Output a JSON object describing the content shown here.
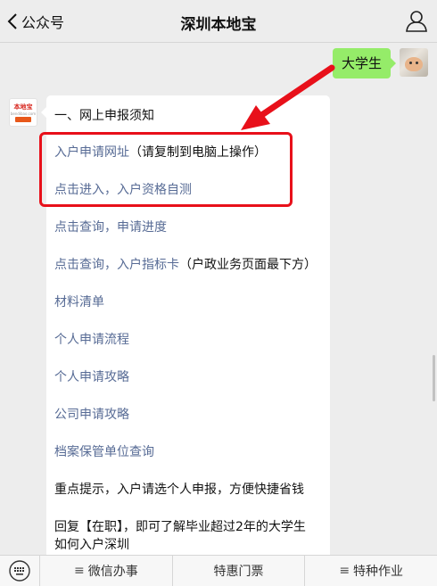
{
  "header": {
    "back_label": "公众号",
    "title": "深圳本地宝"
  },
  "outgoing": {
    "text": "大学生"
  },
  "bot_avatar": {
    "top_text": "本地宝",
    "sub_text": "bendibao.com",
    "badge_text": "深圳"
  },
  "message": {
    "heading": "一、网上申报须知",
    "link1": "入户申请网址",
    "link1_suffix": "（请复制到电脑上操作）",
    "link2": "点击进入，入户资格自测",
    "link3": "点击查询，申请进度",
    "link4": "点击查询，入户指标卡",
    "link4_suffix": "（户政业务页面最下方）",
    "link5": "材料清单",
    "link6": "个人申请流程",
    "link7": "个人申请攻略",
    "link8": "公司申请攻略",
    "link9": "档案保管单位查询",
    "tip": "重点提示，入户请选个人申报，方便快捷省钱",
    "reply_line1": "回复【在职】，即可了解毕业超过2年的大学生",
    "reply_line2": "如何入户深圳"
  },
  "bottom_menu": {
    "item1": "微信办事",
    "item2": "特惠门票",
    "item3": "特种作业"
  },
  "colors": {
    "link": "#576b95",
    "bubble_out": "#95ec69",
    "highlight": "#e8101a"
  }
}
